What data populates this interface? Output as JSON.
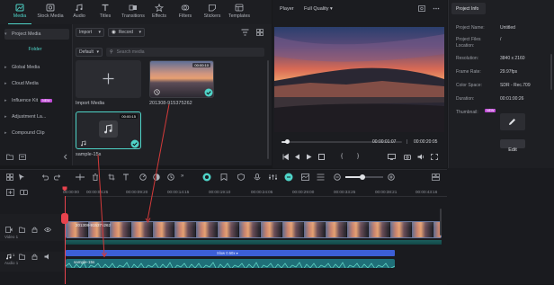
{
  "top_tabs": [
    {
      "label": "Media",
      "icon": "media-icon",
      "active": true
    },
    {
      "label": "Stock Media",
      "icon": "stock-media-icon"
    },
    {
      "label": "Audio",
      "icon": "audio-icon"
    },
    {
      "label": "Titles",
      "icon": "titles-icon"
    },
    {
      "label": "Transitions",
      "icon": "transitions-icon"
    },
    {
      "label": "Effects",
      "icon": "effects-icon"
    },
    {
      "label": "Filters",
      "icon": "filters-icon"
    },
    {
      "label": "Stickers",
      "icon": "stickers-icon"
    },
    {
      "label": "Templates",
      "icon": "templates-icon"
    }
  ],
  "sidebar": {
    "items": [
      {
        "label": "Project Media"
      },
      {
        "label": "Folder"
      },
      {
        "label": "Global Media"
      },
      {
        "label": "Cloud Media"
      },
      {
        "label": "Influence Kit",
        "badge": "NEW"
      },
      {
        "label": "Adjustment La..."
      },
      {
        "label": "Compound Clip"
      }
    ]
  },
  "media": {
    "import_label": "Import",
    "record_label": "Record",
    "sort_label": "Default",
    "search_placeholder": "Search media",
    "items": [
      {
        "name": "Import Media"
      },
      {
        "name": "201308-915375262",
        "duration": "00:00:10"
      },
      {
        "name": "sample-15s",
        "duration": "00:00:15"
      }
    ]
  },
  "player": {
    "label": "Player",
    "quality": "Full Quality",
    "current_time": "00:00:01:07",
    "total_time": "00:00:20:05"
  },
  "project_info": {
    "tab": "Project Info",
    "rows": [
      {
        "key": "Project Name:",
        "value": "Untitled"
      },
      {
        "key": "Project Files Location:",
        "value": "/"
      },
      {
        "key": "Resolution:",
        "value": "3840 x 2160"
      },
      {
        "key": "Frame Rate:",
        "value": "29.97fps"
      },
      {
        "key": "Color Space:",
        "value": "SDR - Rec.709"
      },
      {
        "key": "Duration:",
        "value": "00:01:00:26"
      }
    ],
    "thumbnail_label": "Thumbnail:",
    "thumbnail_badge": "NEW",
    "edit_label": "Edit"
  },
  "timeline": {
    "ruler": [
      "00:00:00",
      "00:00:04:25",
      "00:00:09:20",
      "00:00:14:15",
      "00:00:19:10",
      "00:00:24:05",
      "00:00:29:00",
      "00:00:33:25",
      "00:00:38:21",
      "00:00:43:16"
    ],
    "video_track_label": "Video 1",
    "audio_track_label": "Audio 1",
    "video_clip_name": "201308-915375262",
    "audio_clip_name": "sample-15s",
    "speed_label": "Slow 0.50x",
    "track_badge": "1"
  },
  "colors": {
    "accent": "#4fd4c8",
    "playhead": "#e8434d",
    "audio_clip": "#1f6f78",
    "speed_bar": "#3c5fd6",
    "annotation_arrow": "#d43a3a"
  }
}
